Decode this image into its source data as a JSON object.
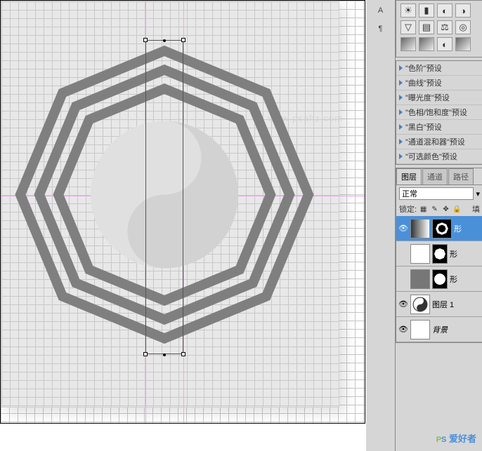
{
  "rail": {
    "char_tool": "A",
    "para_tool": "¶"
  },
  "adjustments": {
    "row1": [
      "☀",
      "▮",
      "◐",
      "◑"
    ],
    "row2": [
      "▽",
      "▤",
      "⚖",
      "◎"
    ],
    "row3": [
      "▩",
      "▦",
      "◐",
      "◇"
    ]
  },
  "presets": [
    "\"色阶\"预设",
    "\"曲线\"预设",
    "\"曝光度\"预设",
    "\"色相/饱和度\"预设",
    "\"黑白\"预设",
    "\"通道混和器\"预设",
    "\"可选颜色\"预设"
  ],
  "layers_panel": {
    "tabs": [
      "图层",
      "通道",
      "路径"
    ],
    "blend_mode": "正常",
    "lock_label": "锁定:",
    "fill_label": "填",
    "layers": [
      {
        "name": "形",
        "selected": true,
        "visible": true
      },
      {
        "name": "形",
        "selected": false,
        "visible": false
      },
      {
        "name": "形",
        "selected": false,
        "visible": false
      },
      {
        "name": "图层 1",
        "selected": false,
        "visible": true
      },
      {
        "name": "背景",
        "selected": false,
        "visible": true
      }
    ]
  },
  "watermark": {
    "p": "P",
    "s": "S",
    "rest": " 爱好者"
  },
  "psahz": "www.psahz.com"
}
